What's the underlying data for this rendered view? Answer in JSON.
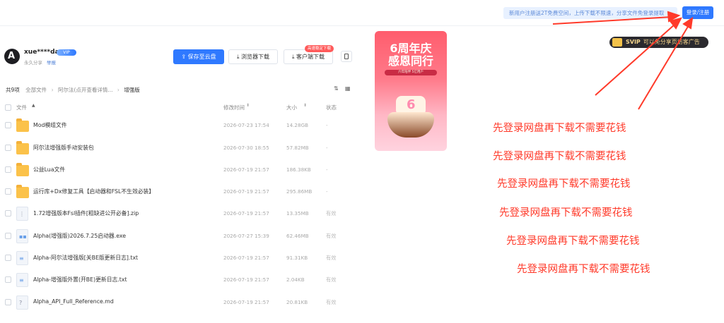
{
  "topbar": {
    "promo_text": "新用户注册送2T免费空间，上传下载不限速，分享文件免登录提取",
    "login_label": "登录/注册"
  },
  "user": {
    "avatar_letter": "A",
    "name": "xue****dan",
    "vip_label": "VIP",
    "share_text": "永久分享",
    "report_label": "举报"
  },
  "actions": {
    "save_label": "保存至云盘",
    "browse_download_label": "浏览器下载",
    "client_download_label": "客户端下载",
    "client_badge": "高速稳定下载"
  },
  "breadcrumb": {
    "count": "共9项",
    "items": [
      "全部文件",
      "阿尔法(点开查看详情...",
      "增强版"
    ]
  },
  "table": {
    "headers": {
      "name": "文件",
      "date": "修改时间",
      "size": "大小",
      "status": "状态"
    },
    "rows": [
      {
        "name": "Mod模组文件",
        "date": "2026-07-23 17:54",
        "size": "14.28GB",
        "status": "-",
        "type": "folder"
      },
      {
        "name": "阿尔法增强版手动安装包",
        "date": "2026-07-30 18:55",
        "size": "57.82MB",
        "status": "-",
        "type": "folder"
      },
      {
        "name": "公益Lua文件",
        "date": "2026-07-19 21:57",
        "size": "186.38KB",
        "status": "-",
        "type": "folder"
      },
      {
        "name": "运行库+Dx修复工具【启动器和FSL不生效必装】",
        "date": "2026-07-19 21:57",
        "size": "295.86MB",
        "status": "-",
        "type": "folder"
      },
      {
        "name": "1.72增强版本Fsl插件[粗缺进公开必备].zip",
        "date": "2026-07-19 21:57",
        "size": "13.35MB",
        "status": "有效",
        "type": "zip"
      },
      {
        "name": "Alpha(增强版)2026.7.25启动器.exe",
        "date": "2026-07-27 15:39",
        "size": "62.46MB",
        "status": "有效",
        "type": "exe"
      },
      {
        "name": "Alpha-阿尔法增强版[关BE版更新日志].txt",
        "date": "2026-07-19 21:57",
        "size": "91.31KB",
        "status": "有效",
        "type": "txt"
      },
      {
        "name": "Alpha-增强版外置(开BE)更新日志.txt",
        "date": "2026-07-19 21:57",
        "size": "2.04KB",
        "status": "有效",
        "type": "txt"
      },
      {
        "name": "Alpha_API_Full_Reference.md",
        "date": "2026-07-19 21:57",
        "size": "20.81KB",
        "status": "有效",
        "type": "md"
      }
    ]
  },
  "ad": {
    "title_line1": "6周年庆",
    "title_line2": "感恩同行",
    "subtitle": "六年陪伴 5亿用户",
    "cake_text": "6"
  },
  "svip": {
    "label": "SVIP",
    "text": "可以免分享页访客广告"
  },
  "notes": [
    "先登录网盘再下载不需要花钱",
    "先登录网盘再下载不需要花钱",
    "先登录网盘再下载不需要花钱",
    "先登录网盘再下载不需要花钱",
    "先登录网盘再下载不需要花钱",
    "先登录网盘再下载不需要花钱"
  ],
  "colors": {
    "accent": "#2f79ff",
    "annotation": "#ff3a2a",
    "folder": "#fbc24a"
  }
}
